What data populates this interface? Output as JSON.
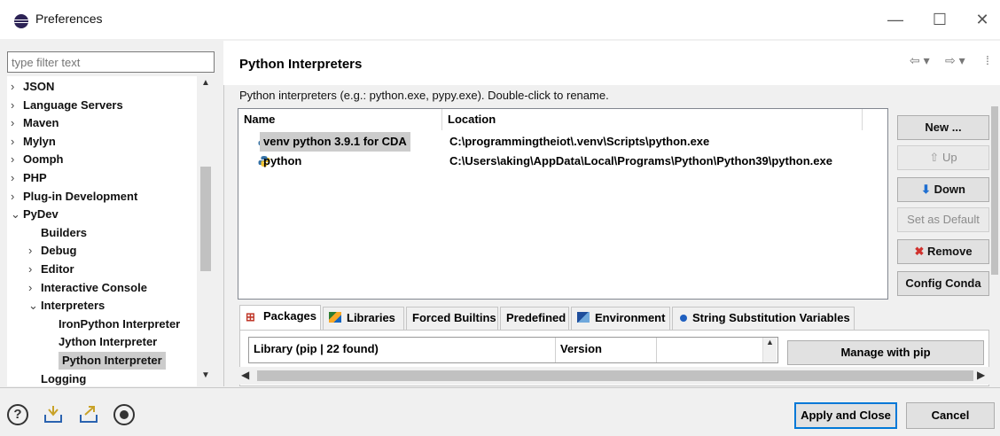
{
  "window": {
    "title": "Preferences",
    "minimize_glyph": "—",
    "maximize_glyph": "☐",
    "close_glyph": "✕"
  },
  "sidebar": {
    "filter_placeholder": "type filter text",
    "items": [
      {
        "label": "JSON",
        "twisty": "›"
      },
      {
        "label": "Language Servers",
        "twisty": "›"
      },
      {
        "label": "Maven",
        "twisty": "›"
      },
      {
        "label": "Mylyn",
        "twisty": "›"
      },
      {
        "label": "Oomph",
        "twisty": "›"
      },
      {
        "label": "PHP",
        "twisty": "›"
      },
      {
        "label": "Plug-in Development",
        "twisty": "›"
      },
      {
        "label": "PyDev",
        "twisty": "⌄"
      },
      {
        "label": "Builders",
        "twisty": ""
      },
      {
        "label": "Debug",
        "twisty": "›"
      },
      {
        "label": "Editor",
        "twisty": "›"
      },
      {
        "label": "Interactive Console",
        "twisty": "›"
      },
      {
        "label": "Interpreters",
        "twisty": "⌄"
      },
      {
        "label": "IronPython Interpreter",
        "twisty": ""
      },
      {
        "label": "Jython Interpreter",
        "twisty": ""
      },
      {
        "label": "Python Interpreter",
        "twisty": ""
      },
      {
        "label": "Logging",
        "twisty": ""
      }
    ]
  },
  "main": {
    "title": "Python Interpreters",
    "description": "Python interpreters (e.g.: python.exe, pypy.exe).  Double-click to rename.",
    "nav_back": "⇦ ▾",
    "nav_forward": "⇨ ▾",
    "nav_more": "⁞",
    "table": {
      "headers": [
        "Name",
        "Location"
      ],
      "rows": [
        {
          "name": "venv python 3.9.1 for CDA",
          "location": "C:\\programmingtheiot\\.venv\\Scripts\\python.exe"
        },
        {
          "name": "python",
          "location": "C:\\Users\\aking\\AppData\\Local\\Programs\\Python\\Python39\\python.exe"
        }
      ]
    },
    "buttons": {
      "new": "New ...",
      "up": "Up",
      "down": "Down",
      "set_default": "Set as Default",
      "remove": "Remove",
      "config_conda": "Config Conda"
    },
    "tabs": [
      "Packages",
      "Libraries",
      "Forced Builtins",
      "Predefined",
      "Environment",
      "String Substitution Variables"
    ],
    "packages": {
      "col_library": "Library (pip | 22 found)",
      "col_version": "Version",
      "manage_button": "Manage with pip"
    }
  },
  "footer": {
    "apply_close": "Apply and Close",
    "cancel": "Cancel",
    "help_glyph": "?"
  },
  "colors": {
    "accent": "#0078d7",
    "selection": "#cccccc",
    "remove_red": "#d0312d",
    "down_blue": "#1f6fd1"
  }
}
